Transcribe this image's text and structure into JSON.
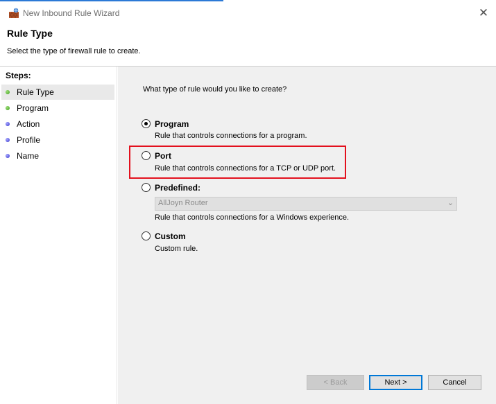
{
  "window": {
    "title": "New Inbound Rule Wizard",
    "close_glyph": "✕"
  },
  "header": {
    "title": "Rule Type",
    "subtitle": "Select the type of firewall rule to create."
  },
  "steps": {
    "heading": "Steps:",
    "items": [
      {
        "label": "Rule Type",
        "status": "done",
        "active": true
      },
      {
        "label": "Program",
        "status": "done",
        "active": false
      },
      {
        "label": "Action",
        "status": "todo",
        "active": false
      },
      {
        "label": "Profile",
        "status": "todo",
        "active": false
      },
      {
        "label": "Name",
        "status": "todo",
        "active": false
      }
    ]
  },
  "content": {
    "question": "What type of rule would you like to create?",
    "options": [
      {
        "title": "Program",
        "description": "Rule that controls connections for a program.",
        "checked": true
      },
      {
        "title": "Port",
        "description": "Rule that controls connections for a TCP or UDP port.",
        "checked": false,
        "highlighted": true
      },
      {
        "title": "Predefined:",
        "description": "Rule that controls connections for a Windows experience.",
        "checked": false
      },
      {
        "title": "Custom",
        "description": "Custom rule.",
        "checked": false
      }
    ],
    "predefined_select": {
      "value": "AllJoyn Router",
      "enabled": false
    }
  },
  "buttons": {
    "back": "< Back",
    "next": "Next >",
    "cancel": "Cancel"
  },
  "colors": {
    "highlight_border": "#e3101d",
    "default_button_border": "#0078d7"
  }
}
